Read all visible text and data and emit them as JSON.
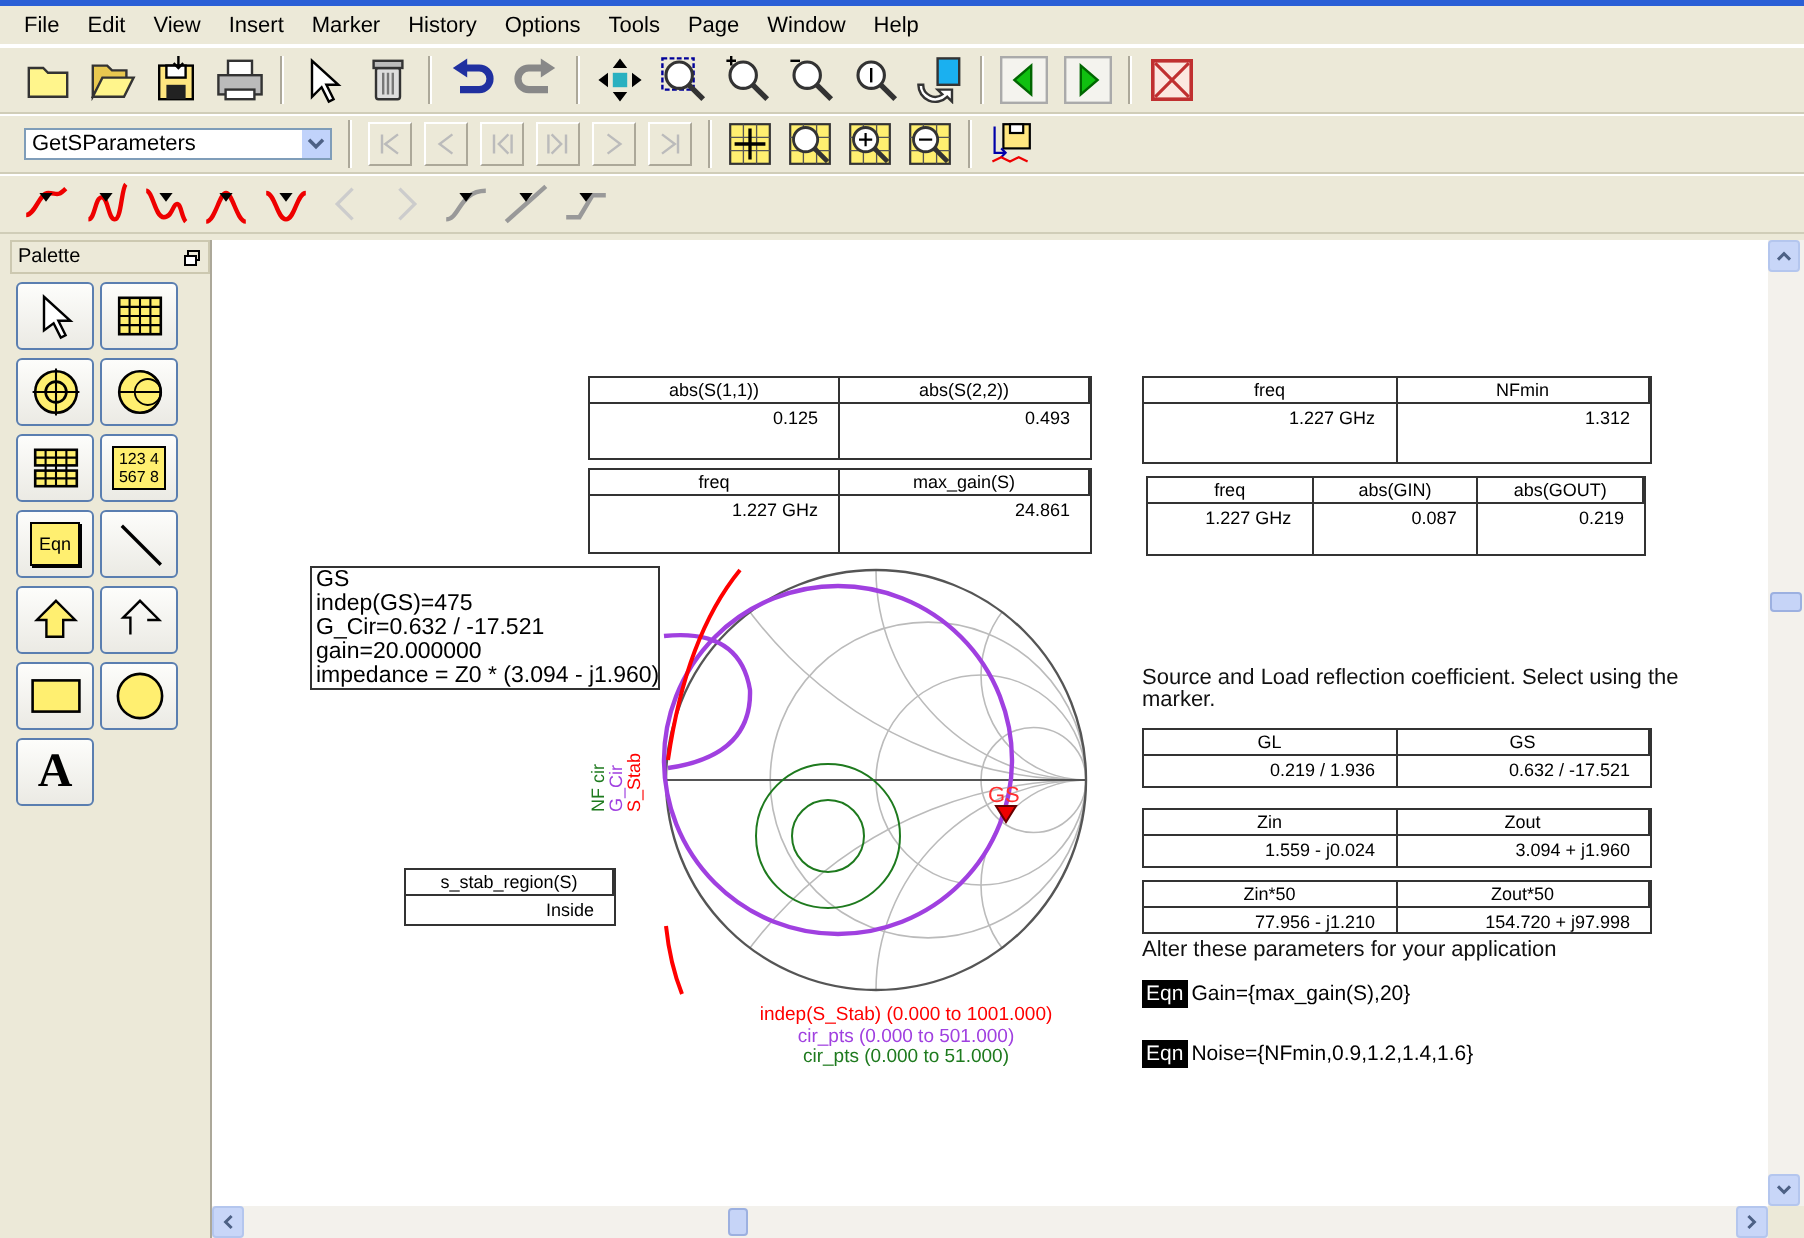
{
  "menu": [
    "File",
    "Edit",
    "View",
    "Insert",
    "Marker",
    "History",
    "Options",
    "Tools",
    "Page",
    "Window",
    "Help"
  ],
  "toolbar": {
    "dropdown_value": "GetSParameters"
  },
  "palette": {
    "title": "Palette",
    "items": [
      {
        "kind": "pointer"
      },
      {
        "kind": "table"
      },
      {
        "kind": "smith"
      },
      {
        "kind": "polar"
      },
      {
        "kind": "grid"
      },
      {
        "kind": "list",
        "lines": [
          "123 4",
          "567 8"
        ]
      },
      {
        "kind": "equation",
        "label": "Eqn"
      },
      {
        "kind": "line"
      },
      {
        "kind": "polygon"
      },
      {
        "kind": "polyline"
      },
      {
        "kind": "rectangle"
      },
      {
        "kind": "ellipse"
      },
      {
        "kind": "text",
        "label": "A"
      }
    ]
  },
  "canvas": {
    "tables": [
      {
        "columns": [
          "abs(S(1,1))",
          "abs(S(2,2))"
        ],
        "rows": [
          [
            "0.125",
            "0.493"
          ]
        ]
      },
      {
        "columns": [
          "freq",
          "max_gain(S)"
        ],
        "rows": [
          [
            "1.227 GHz",
            "24.861"
          ]
        ]
      },
      {
        "columns": [
          "freq",
          "NFmin"
        ],
        "rows": [
          [
            "1.227 GHz",
            "1.312"
          ]
        ]
      },
      {
        "columns": [
          "freq",
          "abs(GIN)",
          "abs(GOUT)"
        ],
        "rows": [
          [
            "1.227 GHz",
            "0.087",
            "0.219"
          ]
        ]
      },
      {
        "columns": [
          "s_stab_region(S)"
        ],
        "rows": [
          [
            "Inside"
          ]
        ]
      },
      {
        "columns": [
          "GL",
          "GS"
        ],
        "rows": [
          [
            "0.219 / 1.936",
            "0.632 / -17.521"
          ]
        ]
      },
      {
        "columns": [
          "Zin",
          "Zout"
        ],
        "rows": [
          [
            "1.559 - j0.024",
            "3.094 + j1.960"
          ]
        ]
      },
      {
        "columns": [
          "Zin*50",
          "Zout*50"
        ],
        "rows": [
          [
            "77.956 - j1.210",
            "154.720 + j97.998"
          ]
        ]
      }
    ],
    "marker_readout": [
      "GS",
      "indep(GS)=475",
      "G_Cir=0.632 / -17.521",
      "gain=20.000000",
      "impedance = Z0 * (3.094 - j1.960)"
    ],
    "notes": [
      "Source and Load reflection coefficient. Select using the marker.",
      "Alter these parameters for your application"
    ],
    "equations": [
      {
        "badge": "Eqn",
        "text": "Gain={max_gain(S),20}"
      },
      {
        "badge": "Eqn",
        "text": "Noise={NFmin,0.9,1.2,1.4,1.6}"
      }
    ],
    "chart": {
      "trace_labels": [
        {
          "text": "NF cir",
          "color": "#1e7a1e"
        },
        {
          "text": "G_Cir",
          "color": "#a040e0"
        },
        {
          "text": "S_Stab",
          "color": "#ff0000"
        }
      ],
      "marker": {
        "label": "GS"
      },
      "legend": [
        {
          "text": "indep(S_Stab) (0.000 to 1001.000)",
          "color": "#ff0000"
        },
        {
          "text": "cir_pts (0.000 to 501.000)",
          "color": "#a040e0"
        },
        {
          "text": "cir_pts (0.000 to 51.000)",
          "color": "#1e7a1e"
        }
      ]
    }
  }
}
